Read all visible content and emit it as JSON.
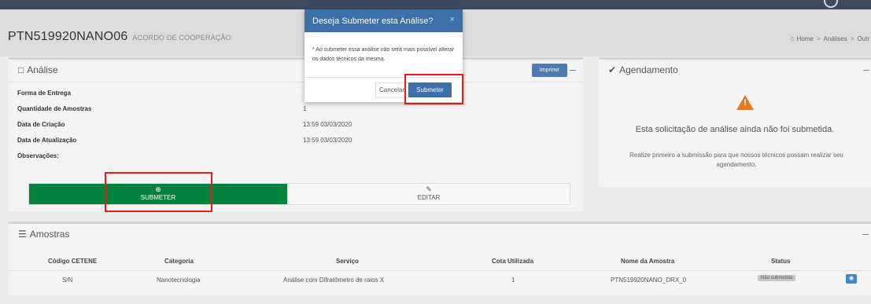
{
  "page": {
    "title": "PTN519920NANO06",
    "subtitle": "ACORDO DE COOPERAÇÃO",
    "breadcrumb": [
      "Home",
      "Análises",
      "Outr"
    ]
  },
  "analise": {
    "title": "Análise",
    "print_label": "Imprimir",
    "fields": [
      {
        "label": "Forma de Entrega",
        "value": ""
      },
      {
        "label": "Quantidade de Amostras",
        "value": "1"
      },
      {
        "label": "Data de Criação",
        "value": "13:59 03/03/2020"
      },
      {
        "label": "Data de Atualização",
        "value": "13:59 03/03/2020"
      },
      {
        "label": "Observações:",
        "value": ""
      }
    ],
    "submit_label": "SUBMETER",
    "edit_label": "EDITAR"
  },
  "agendamento": {
    "title": "Agendamento",
    "message": "Esta solicitação de análise ainda não foi submetida.",
    "submessage": "Realize primeiro a submissão para que nossos técnicos possam realizar seu agendamento."
  },
  "amostras": {
    "title": "Amostras",
    "columns": [
      "Código CETENE",
      "Categoria",
      "Serviço",
      "Cota Utilizada",
      "Nome da Amostra",
      "Status"
    ],
    "rows": [
      [
        "S/N",
        "Nanotecnologia",
        "Análise com Difratômetro de raios X",
        "1",
        "PTN519920NANO_DRX_0",
        "Não submetida"
      ]
    ]
  },
  "modal": {
    "title": "Deseja Submeter esta Análise?",
    "close": "×",
    "body": "* Ao submeter essa análise não será mais possível alterar os dados técnicos da mesma.",
    "cancel_label": "Cancelar",
    "submit_label": "Submeter"
  },
  "colors": {
    "submit_green": "#00843d",
    "modal_blue": "#3d6fa8",
    "warning_orange": "#e87722",
    "highlight_red": "#e41b17"
  }
}
